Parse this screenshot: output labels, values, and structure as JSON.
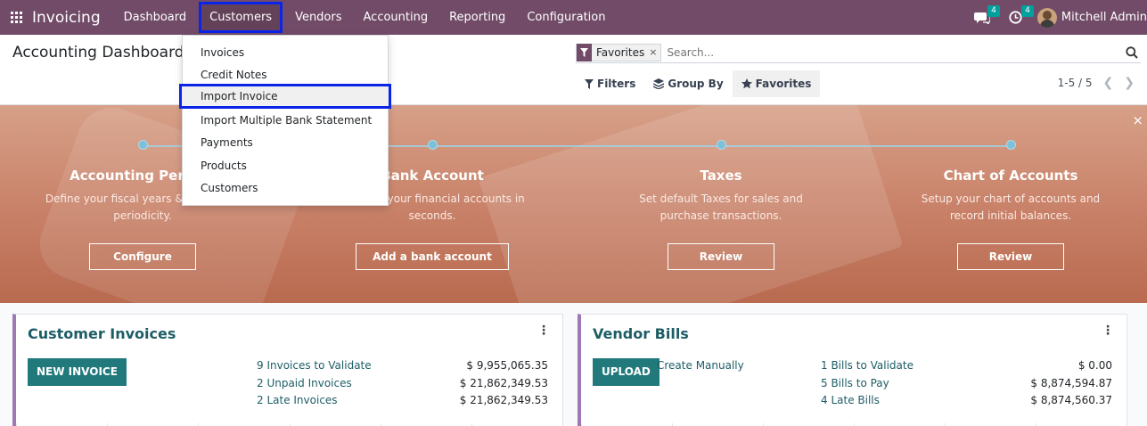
{
  "navbar": {
    "app_name": "Invoicing",
    "menu": [
      "Dashboard",
      "Customers",
      "Vendors",
      "Accounting",
      "Reporting",
      "Configuration"
    ],
    "messages_count": "4",
    "activities_count": "4",
    "user_name": "Mitchell Admin"
  },
  "control_panel": {
    "title": "Accounting Dashboard",
    "facet_label": "Favorites",
    "facet_close": "×",
    "search_placeholder": "Search...",
    "filters_label": "Filters",
    "group_by_label": "Group By",
    "favorites_label": "Favorites",
    "pager": "1-5 / 5"
  },
  "customers_dropdown": {
    "items": [
      "Invoices",
      "Credit Notes",
      "Import Invoice",
      "Import Multiple Bank Statement",
      "Payments",
      "Products",
      "Customers"
    ],
    "highlighted": "Import Invoice"
  },
  "banner": {
    "close": "×",
    "steps": [
      {
        "title": "Accounting Periods",
        "desc": "Define your fiscal years & tax return periodicity.",
        "button": "Configure"
      },
      {
        "title": "Bank Account",
        "desc": "Connect your financial accounts in seconds.",
        "button": "Add a bank account"
      },
      {
        "title": "Taxes",
        "desc": "Set default Taxes for sales and purchase transactions.",
        "button": "Review"
      },
      {
        "title": "Chart of Accounts",
        "desc": "Setup your chart of accounts and record initial balances.",
        "button": "Review"
      }
    ]
  },
  "customer_invoices": {
    "title": "Customer Invoices",
    "button": "NEW INVOICE",
    "rows": [
      {
        "label": "9 Invoices to Validate",
        "amount": "$ 9,955,065.35"
      },
      {
        "label": "2 Unpaid Invoices",
        "amount": "$ 21,862,349.53"
      },
      {
        "label": "2 Late Invoices",
        "amount": "$ 21,862,349.53"
      }
    ]
  },
  "vendor_bills": {
    "title": "Vendor Bills",
    "button": "UPLOAD",
    "create_manually": "Create Manually",
    "rows": [
      {
        "label": "1 Bills to Validate",
        "amount": "$ 0.00"
      },
      {
        "label": "5 Bills to Pay",
        "amount": "$ 8,874,594.87"
      },
      {
        "label": "4 Late Bills",
        "amount": "$ 8,874,560.37"
      }
    ]
  },
  "colors": {
    "navbar": "#714b67",
    "highlight_outline": "#0b24e6",
    "primary_button": "#21797c",
    "card_accent": "#9e79b4"
  }
}
